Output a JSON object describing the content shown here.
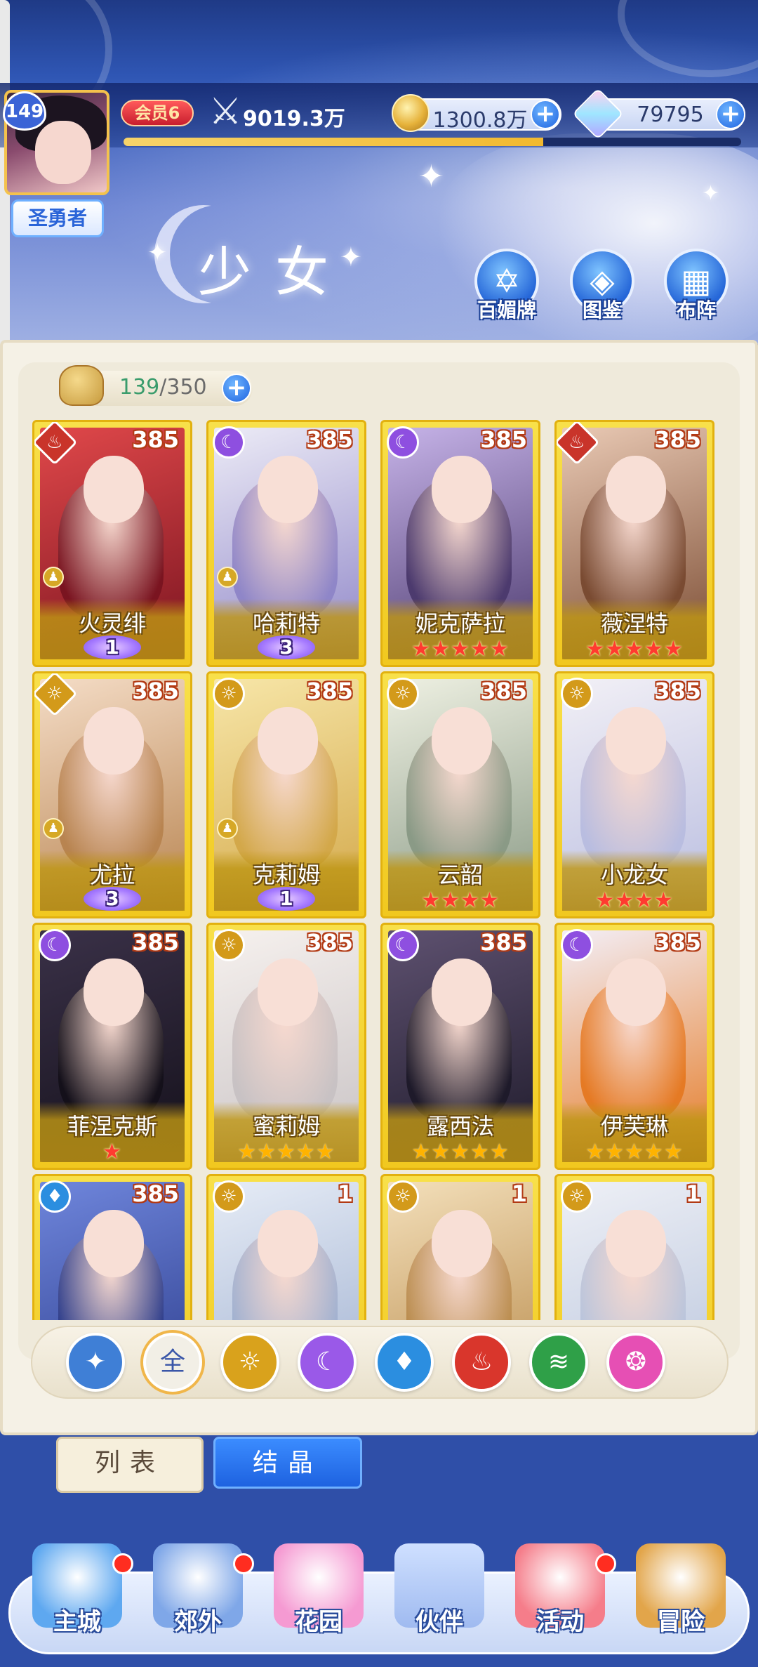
{
  "player": {
    "level": "149",
    "title": "圣勇者",
    "vip_label": "会员6",
    "power": "9019.3万",
    "gold": "1300.8万",
    "gems": "79795",
    "exp_fraction": 0.68
  },
  "header": {
    "page_title": "少女",
    "buttons": [
      {
        "label": "百媚牌",
        "icon": "card-hexagram-icon"
      },
      {
        "label": "图鉴",
        "icon": "book-icon"
      },
      {
        "label": "布阵",
        "icon": "grid-formation-icon"
      }
    ]
  },
  "inventory": {
    "have": "139",
    "separator": "/",
    "max": "350"
  },
  "cards": [
    {
      "name": "火灵绯",
      "level": "385",
      "element": "fire",
      "element_icon": "fire-icon",
      "rank_type": "wing",
      "rank": "1",
      "stars": 0
    },
    {
      "name": "哈莉特",
      "level": "385",
      "element": "moon",
      "element_icon": "moon-icon",
      "rank_type": "wing",
      "rank": "3",
      "stars": 0
    },
    {
      "name": "妮克萨拉",
      "level": "385",
      "element": "moon",
      "element_icon": "moon-icon",
      "rank_type": "stars",
      "rank": "",
      "stars": 5
    },
    {
      "name": "薇涅特",
      "level": "385",
      "element": "fire",
      "element_icon": "fire-icon",
      "rank_type": "stars",
      "rank": "",
      "stars": 5
    },
    {
      "name": "尤拉",
      "level": "385",
      "element": "sun",
      "element_icon": "sun-icon",
      "rank_type": "wing",
      "rank": "3",
      "stars": 0
    },
    {
      "name": "克莉姆",
      "level": "385",
      "element": "sun",
      "element_icon": "sun-icon",
      "rank_type": "wing",
      "rank": "1",
      "stars": 0
    },
    {
      "name": "云韶",
      "level": "385",
      "element": "sun",
      "element_icon": "sun-icon",
      "rank_type": "stars",
      "rank": "",
      "stars": 4
    },
    {
      "name": "小龙女",
      "level": "385",
      "element": "sun",
      "element_icon": "sun-icon",
      "rank_type": "stars",
      "rank": "",
      "stars": 4
    },
    {
      "name": "菲涅克斯",
      "level": "385",
      "element": "moon",
      "element_icon": "moon-icon",
      "rank_type": "stars",
      "rank": "",
      "stars": 1
    },
    {
      "name": "蜜莉姆",
      "level": "385",
      "element": "sun",
      "element_icon": "sun-icon",
      "rank_type": "gold-stars",
      "rank": "",
      "stars": 5
    },
    {
      "name": "露西法",
      "level": "385",
      "element": "moon",
      "element_icon": "moon-icon",
      "rank_type": "gold-stars",
      "rank": "",
      "stars": 5
    },
    {
      "name": "伊芙琳",
      "level": "385",
      "element": "moon",
      "element_icon": "moon-icon",
      "rank_type": "gold-stars",
      "rank": "",
      "stars": 5
    },
    {
      "name": "",
      "level": "385",
      "element": "water",
      "element_icon": "water-icon",
      "rank_type": "none",
      "rank": "",
      "stars": 0
    },
    {
      "name": "",
      "level": "1",
      "element": "sun",
      "element_icon": "sun-icon",
      "rank_type": "none",
      "rank": "",
      "stars": 0
    },
    {
      "name": "",
      "level": "1",
      "element": "sun",
      "element_icon": "sun-icon",
      "rank_type": "none",
      "rank": "",
      "stars": 0
    },
    {
      "name": "",
      "level": "1",
      "element": "sun",
      "element_icon": "sun-icon",
      "rank_type": "none",
      "rank": "",
      "stars": 0
    }
  ],
  "filters": [
    {
      "id": "wind",
      "icon": "wind-icon",
      "label": "",
      "color": "#3f7fd6"
    },
    {
      "id": "all",
      "icon": "all-icon",
      "label": "全",
      "color": "#f2efe6",
      "selected": true
    },
    {
      "id": "sun",
      "icon": "sun-icon",
      "label": "",
      "color": "#d9a21c"
    },
    {
      "id": "moon",
      "icon": "moon-icon",
      "label": "",
      "color": "#9a59e8"
    },
    {
      "id": "water",
      "icon": "water-icon",
      "label": "",
      "color": "#2b8ee0"
    },
    {
      "id": "fire",
      "icon": "fire-icon",
      "label": "",
      "color": "#d9362c"
    },
    {
      "id": "earth",
      "icon": "tornado-icon",
      "label": "",
      "color": "#2fa048"
    },
    {
      "id": "love",
      "icon": "heart-orb-icon",
      "label": "",
      "color": "#e64fb4"
    }
  ],
  "tabs": {
    "list": "列表",
    "crystal": "结晶"
  },
  "nav": [
    {
      "label": "主城",
      "icon": "castle-icon",
      "dot": true
    },
    {
      "label": "郊外",
      "icon": "portal-icon",
      "dot": true
    },
    {
      "label": "花园",
      "icon": "heart-garden-icon",
      "dot": false
    },
    {
      "label": "伙伴",
      "icon": "partner-icon",
      "dot": false,
      "active": true
    },
    {
      "label": "活动",
      "icon": "gift-icon",
      "dot": true
    },
    {
      "label": "冒险",
      "icon": "compass-icon",
      "dot": false
    }
  ],
  "colors": {
    "card_gold": "#f1c81f",
    "primary_blue": "#1e63e0",
    "element_fire": "#d9362c",
    "element_moon": "#9a59e8",
    "element_sun": "#d9a21c",
    "element_water": "#2b8ee0"
  }
}
